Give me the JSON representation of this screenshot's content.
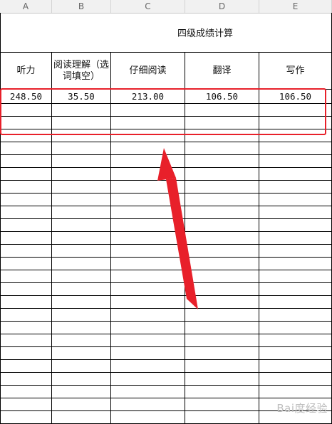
{
  "columns": [
    "A",
    "B",
    "C",
    "D",
    "E"
  ],
  "sheet": {
    "title": "四级成绩计算",
    "headers": [
      "听力",
      "阅读理解（选词填空）",
      "仔细阅读",
      "翻译",
      "写作"
    ],
    "row1": [
      "248.50",
      "35.50",
      "213.00",
      "106.50",
      "106.50"
    ]
  },
  "annotation": {
    "highlight_color": "#e8202a",
    "arrow_color": "#e8202a"
  },
  "watermark": "Bai度经验"
}
